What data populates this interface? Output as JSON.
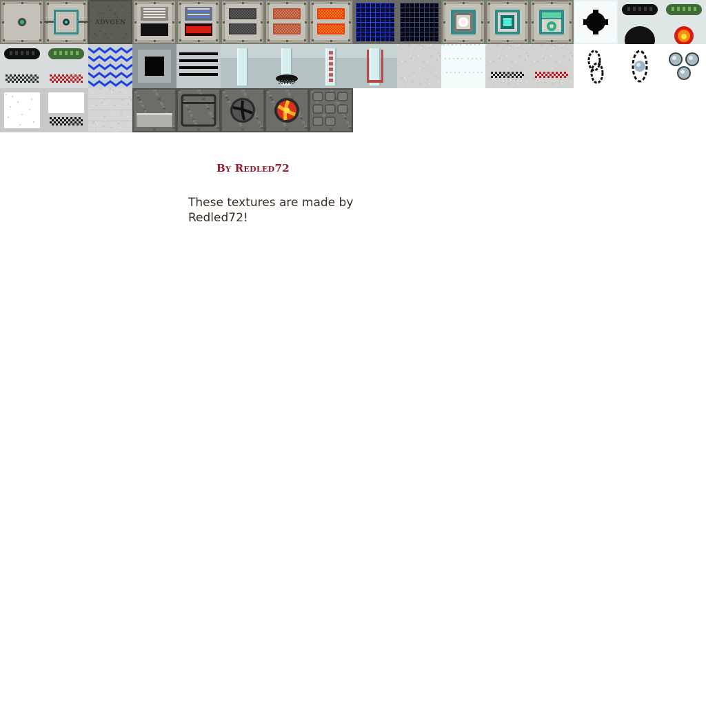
{
  "sheet": {
    "advgen_label": "ADVGEN"
  },
  "tiles": [
    {
      "name": "machine-side-plain",
      "icon": "machine-dot-icon"
    },
    {
      "name": "machine-side-teal",
      "icon": "teal-frame-dot-icon"
    },
    {
      "name": "advgen-plate",
      "icon": "advgen-label-plate"
    },
    {
      "name": "generator-front-off",
      "icon": "vent-off-icon"
    },
    {
      "name": "generator-front-on",
      "icon": "vent-on-icon"
    },
    {
      "name": "generator-slots-off",
      "icon": "slots-off-icon"
    },
    {
      "name": "generator-slots-copper",
      "icon": "slots-copper-icon"
    },
    {
      "name": "generator-slots-hot",
      "icon": "slots-hot-icon"
    },
    {
      "name": "solar-panel-blue",
      "icon": "solar-grid-icon"
    },
    {
      "name": "solar-panel-dark",
      "icon": "solar-grid-dark-icon"
    },
    {
      "name": "core-white",
      "icon": "core-white-icon"
    },
    {
      "name": "core-teal",
      "icon": "core-teal-icon"
    },
    {
      "name": "core-recycle",
      "icon": "recycle-icon"
    },
    {
      "name": "ice-black-orb",
      "icon": "black-orb-icon"
    },
    {
      "name": "capsule-black",
      "icon": "capsule-black-icon"
    },
    {
      "name": "capsule-green-fire",
      "icon": "fire-icon"
    },
    {
      "name": "capsule-black-checker",
      "icon": "checker-icon"
    },
    {
      "name": "capsule-green-red-checker",
      "icon": "red-checker-icon"
    },
    {
      "name": "water-waves",
      "icon": "wave-icon"
    },
    {
      "name": "black-square",
      "icon": "black-square-icon"
    },
    {
      "name": "striped-lines",
      "icon": "stripes-icon"
    },
    {
      "name": "glass-tube-empty",
      "icon": "tube-icon"
    },
    {
      "name": "glass-tube-black",
      "icon": "tube-black-icon"
    },
    {
      "name": "glass-tube-red-dots",
      "icon": "tube-red-icon"
    },
    {
      "name": "glass-tube-red-frame",
      "icon": "tube-red-frame-icon"
    },
    {
      "name": "stone-plain",
      "icon": "stone-icon"
    },
    {
      "name": "ice-block",
      "icon": "ice-icon"
    },
    {
      "name": "stone-black-checker",
      "icon": "checker-strip-icon"
    },
    {
      "name": "stone-red-checker",
      "icon": "red-checker-strip-icon"
    },
    {
      "name": "chain-link",
      "icon": "chain-icon"
    },
    {
      "name": "orb-ring",
      "icon": "orb-ring-icon"
    },
    {
      "name": "orb-cluster",
      "icon": "orb-cluster-icon"
    },
    {
      "name": "ice-panel",
      "icon": "ice-panel-icon"
    },
    {
      "name": "ice-panel-checker",
      "icon": "ice-checker-icon"
    },
    {
      "name": "stone-bricks",
      "icon": "stone-bricks-icon"
    },
    {
      "name": "cobble-slab",
      "icon": "cobble-slab-icon"
    },
    {
      "name": "cobble-frame",
      "icon": "cobble-frame-icon"
    },
    {
      "name": "cobble-fan",
      "icon": "fan-icon"
    },
    {
      "name": "cobble-fire-fan",
      "icon": "fire-fan-icon"
    },
    {
      "name": "cobblestone",
      "icon": "cobblestone-icon"
    }
  ],
  "credit": {
    "signature": "By Redled72",
    "note": "These textures are made by Redled72!"
  }
}
